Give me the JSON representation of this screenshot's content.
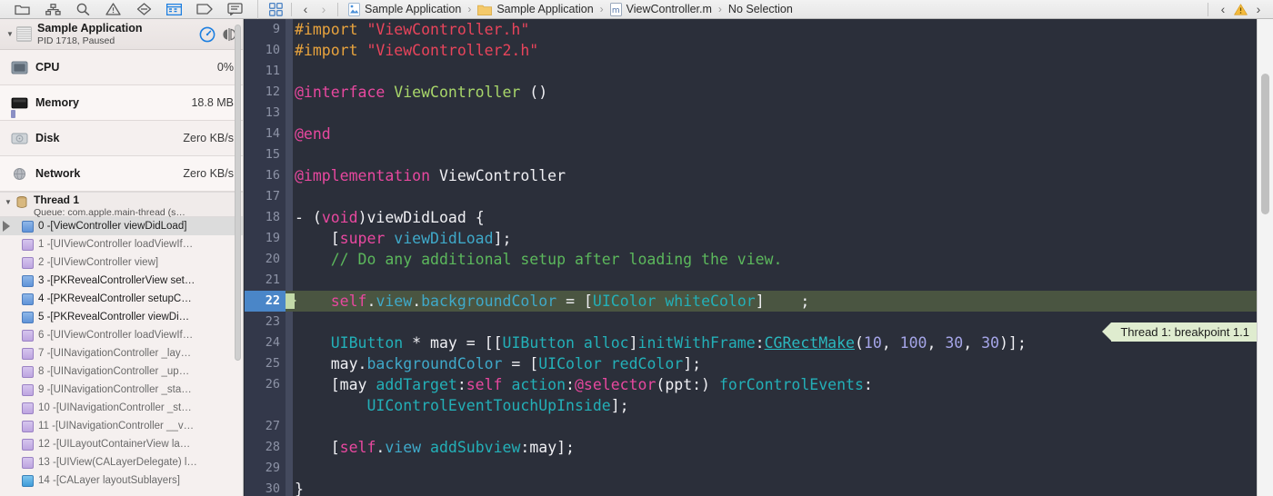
{
  "toolbar": {
    "nav_icons": [
      {
        "name": "folder-icon",
        "label": "Project navigator"
      },
      {
        "name": "hierarchy-icon",
        "label": "Symbol navigator"
      },
      {
        "name": "search-icon",
        "label": "Find navigator"
      },
      {
        "name": "warning-triangle-icon",
        "label": "Issue navigator"
      },
      {
        "name": "diamond-icon",
        "label": "Test navigator"
      },
      {
        "name": "debug-gauge-icon",
        "label": "Debug navigator"
      },
      {
        "name": "tag-icon",
        "label": "Breakpoint navigator"
      },
      {
        "name": "message-icon",
        "label": "Report navigator"
      }
    ],
    "grid_icon": "grid-icon",
    "back_chevron": "‹",
    "forward_chevron": "›",
    "far_back_chevron": "‹",
    "far_forward_chevron": "›",
    "warning_icon": "warning-triangle-icon"
  },
  "breadcrumb": {
    "items": [
      {
        "label": "Sample Application",
        "icon": "project-icon"
      },
      {
        "label": "Sample Application",
        "icon": "folder-icon"
      },
      {
        "label": "ViewController.m",
        "icon": "m-file-icon"
      },
      {
        "label": "No Selection",
        "icon": "none"
      }
    ],
    "separator": "›"
  },
  "sidebar": {
    "app": {
      "title": "Sample Application",
      "subtitle": "PID 1718, Paused",
      "disclosure": "▼",
      "gauge_icon": "speedometer-icon",
      "split_icon": "split-view-icon"
    },
    "gauges": [
      {
        "name": "CPU",
        "value": "0%",
        "icon": "cpu-icon"
      },
      {
        "name": "Memory",
        "value": "18.8 MB",
        "icon": "memory-icon"
      },
      {
        "name": "Disk",
        "value": "Zero KB/s",
        "icon": "disk-icon"
      },
      {
        "name": "Network",
        "value": "Zero KB/s",
        "icon": "network-icon"
      }
    ],
    "thread": {
      "title": "Thread 1",
      "subtitle": "Queue: com.apple.main-thread (s…",
      "disclosure": "▼",
      "icon": "thread-icon"
    },
    "frames": [
      {
        "label": "0 -[ViewController viewDidLoad]",
        "kind": "user",
        "selected": true
      },
      {
        "label": "1 -[UIViewController loadViewIf…",
        "kind": "sys",
        "dim": true
      },
      {
        "label": "2 -[UIViewController view]",
        "kind": "sys",
        "dim": true
      },
      {
        "label": "3 -[PKRevealControllerView set…",
        "kind": "user",
        "dim": false
      },
      {
        "label": "4 -[PKRevealController setupC…",
        "kind": "user",
        "dim": false
      },
      {
        "label": "5 -[PKRevealController viewDi…",
        "kind": "user",
        "dim": false
      },
      {
        "label": "6 -[UIViewController loadViewIf…",
        "kind": "sys",
        "dim": true
      },
      {
        "label": "7 -[UINavigationController _lay…",
        "kind": "sys",
        "dim": true
      },
      {
        "label": "8 -[UINavigationController _up…",
        "kind": "sys",
        "dim": true
      },
      {
        "label": "9 -[UINavigationController _sta…",
        "kind": "sys",
        "dim": true
      },
      {
        "label": "10 -[UINavigationController _st…",
        "kind": "sys",
        "dim": true
      },
      {
        "label": "11 -[UINavigationController __v…",
        "kind": "sys",
        "dim": true
      },
      {
        "label": "12 -[UILayoutContainerView la…",
        "kind": "sys",
        "dim": true
      },
      {
        "label": "13 -[UIView(CALayerDelegate) l…",
        "kind": "sys",
        "dim": true
      },
      {
        "label": "14 -[CALayer layoutSublayers]",
        "kind": "ca",
        "dim": true
      }
    ]
  },
  "editor": {
    "breakpoint_annotation": "Thread 1: breakpoint 1.1",
    "breakpoint_line": 22,
    "lines": [
      {
        "n": 9,
        "tokens": [
          {
            "t": "#import ",
            "c": "c-pre"
          },
          {
            "t": "\"ViewController.h\"",
            "c": "c-str"
          }
        ]
      },
      {
        "n": 10,
        "tokens": [
          {
            "t": "#import ",
            "c": "c-pre"
          },
          {
            "t": "\"ViewController2.h\"",
            "c": "c-str"
          }
        ]
      },
      {
        "n": 11,
        "tokens": []
      },
      {
        "n": 12,
        "tokens": [
          {
            "t": "@interface ",
            "c": "c-key"
          },
          {
            "t": "ViewController ",
            "c": "c-type"
          },
          {
            "t": "()",
            "c": "c-plain"
          }
        ]
      },
      {
        "n": 13,
        "tokens": []
      },
      {
        "n": 14,
        "tokens": [
          {
            "t": "@end",
            "c": "c-key"
          }
        ]
      },
      {
        "n": 15,
        "tokens": []
      },
      {
        "n": 16,
        "tokens": [
          {
            "t": "@implementation ",
            "c": "c-key"
          },
          {
            "t": "ViewController",
            "c": "c-plain"
          }
        ]
      },
      {
        "n": 17,
        "tokens": []
      },
      {
        "n": 18,
        "tokens": [
          {
            "t": "- (",
            "c": "c-plain"
          },
          {
            "t": "void",
            "c": "c-key"
          },
          {
            "t": ")viewDidLoad {",
            "c": "c-plain"
          }
        ]
      },
      {
        "n": 19,
        "tokens": [
          {
            "t": "    [",
            "c": "c-plain"
          },
          {
            "t": "super ",
            "c": "c-key"
          },
          {
            "t": "viewDidLoad",
            "c": "c-prop"
          },
          {
            "t": "];",
            "c": "c-plain"
          }
        ]
      },
      {
        "n": 20,
        "tokens": [
          {
            "t": "    // Do any additional setup after loading the view.",
            "c": "c-cmt"
          }
        ]
      },
      {
        "n": 21,
        "tokens": []
      },
      {
        "n": 22,
        "tokens": [
          {
            "t": "    ",
            "c": "c-plain"
          },
          {
            "t": "self",
            "c": "c-key"
          },
          {
            "t": ".",
            "c": "c-plain"
          },
          {
            "t": "view",
            "c": "c-prop"
          },
          {
            "t": ".",
            "c": "c-plain"
          },
          {
            "t": "backgroundColor",
            "c": "c-prop"
          },
          {
            "t": " = [",
            "c": "c-plain"
          },
          {
            "t": "UIColor whiteColor",
            "c": "c-meth"
          },
          {
            "t": "]    ;",
            "c": "c-plain"
          }
        ]
      },
      {
        "n": 23,
        "tokens": []
      },
      {
        "n": 24,
        "tokens": [
          {
            "t": "    ",
            "c": "c-plain"
          },
          {
            "t": "UIButton",
            "c": "c-meth"
          },
          {
            "t": " * may = [[",
            "c": "c-plain"
          },
          {
            "t": "UIButton alloc",
            "c": "c-meth"
          },
          {
            "t": "]",
            "c": "c-plain"
          },
          {
            "t": "initWithFrame",
            "c": "c-meth"
          },
          {
            "t": ":",
            "c": "c-plain"
          },
          {
            "t": "CGRectMake",
            "c": "c-fn"
          },
          {
            "t": "(",
            "c": "c-plain"
          },
          {
            "t": "10",
            "c": "c-num"
          },
          {
            "t": ", ",
            "c": "c-plain"
          },
          {
            "t": "100",
            "c": "c-num"
          },
          {
            "t": ", ",
            "c": "c-plain"
          },
          {
            "t": "30",
            "c": "c-num"
          },
          {
            "t": ", ",
            "c": "c-plain"
          },
          {
            "t": "30",
            "c": "c-num"
          },
          {
            "t": ")];",
            "c": "c-plain"
          }
        ]
      },
      {
        "n": 25,
        "tokens": [
          {
            "t": "    may.",
            "c": "c-plain"
          },
          {
            "t": "backgroundColor",
            "c": "c-prop"
          },
          {
            "t": " = [",
            "c": "c-plain"
          },
          {
            "t": "UIColor redColor",
            "c": "c-meth"
          },
          {
            "t": "];",
            "c": "c-plain"
          }
        ]
      },
      {
        "n": 26,
        "tokens": [
          {
            "t": "    [may ",
            "c": "c-plain"
          },
          {
            "t": "addTarget",
            "c": "c-meth"
          },
          {
            "t": ":",
            "c": "c-plain"
          },
          {
            "t": "self",
            "c": "c-key"
          },
          {
            "t": " ",
            "c": "c-plain"
          },
          {
            "t": "action",
            "c": "c-meth"
          },
          {
            "t": ":",
            "c": "c-plain"
          },
          {
            "t": "@selector",
            "c": "c-key"
          },
          {
            "t": "(ppt:) ",
            "c": "c-plain"
          },
          {
            "t": "forControlEvents",
            "c": "c-meth"
          },
          {
            "t": ":",
            "c": "c-plain"
          }
        ]
      },
      {
        "n": null,
        "tokens": [
          {
            "t": "        ",
            "c": "c-plain"
          },
          {
            "t": "UIControlEventTouchUpInside",
            "c": "c-meth"
          },
          {
            "t": "];",
            "c": "c-plain"
          }
        ]
      },
      {
        "n": 27,
        "tokens": []
      },
      {
        "n": 28,
        "tokens": [
          {
            "t": "    [",
            "c": "c-plain"
          },
          {
            "t": "self",
            "c": "c-key"
          },
          {
            "t": ".",
            "c": "c-plain"
          },
          {
            "t": "view",
            "c": "c-prop"
          },
          {
            "t": " ",
            "c": "c-plain"
          },
          {
            "t": "addSubview",
            "c": "c-meth"
          },
          {
            "t": ":may];",
            "c": "c-plain"
          }
        ]
      },
      {
        "n": 29,
        "tokens": []
      },
      {
        "n": 30,
        "tokens": [
          {
            "t": "}",
            "c": "c-plain"
          }
        ]
      }
    ]
  },
  "colors": {
    "editor_bg": "#2b2f3a",
    "gutter_bg": "#33384a",
    "breakpoint_line_bg": "#4a5541",
    "breakpoint_gutter": "#4a86c8",
    "annotation_bg": "#dfeccf",
    "sidebar_bg": "#f5f0ef",
    "accent_blue": "#4a86c8"
  }
}
